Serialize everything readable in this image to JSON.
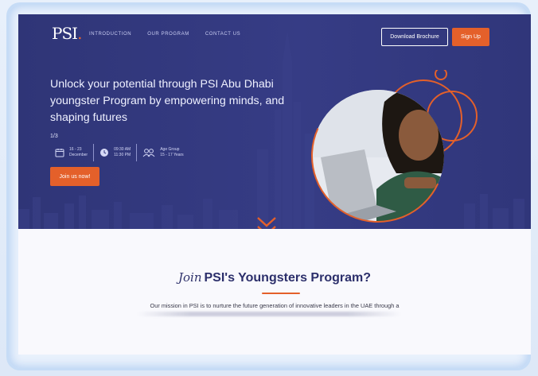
{
  "header": {
    "logo_text": "PSI",
    "logo_dot": ".",
    "nav": [
      "INTRODUCTION",
      "OUR PROGRAM",
      "CONTACT US"
    ],
    "brochure_label": "Download Brochure",
    "signup_label": "Sign Up"
  },
  "hero": {
    "headline_lines": [
      "Unlock your potential through PSI Abu Dhabi",
      "youngster Program by empowering minds, and",
      "shaping futures"
    ],
    "slide_counter": "1/3",
    "dates": [
      "16 - 23",
      "December"
    ],
    "times": [
      "09:30 AM",
      "11:30 PM"
    ],
    "age": [
      "Age Group",
      "15 - 17 Years"
    ],
    "join_label": "Join us now!"
  },
  "section": {
    "title_script": "Join",
    "title": "PSI's Youngsters Program?",
    "mission": "Our mission in PSI is to nurture the future generation of innovative leaders in the UAE through a"
  },
  "colors": {
    "hero_bg": "#343a80",
    "accent": "#e4602a",
    "title_text": "#2c2f6b"
  },
  "icons": [
    "calendar-icon",
    "clock-icon",
    "people-icon",
    "chevron-down-icon"
  ]
}
